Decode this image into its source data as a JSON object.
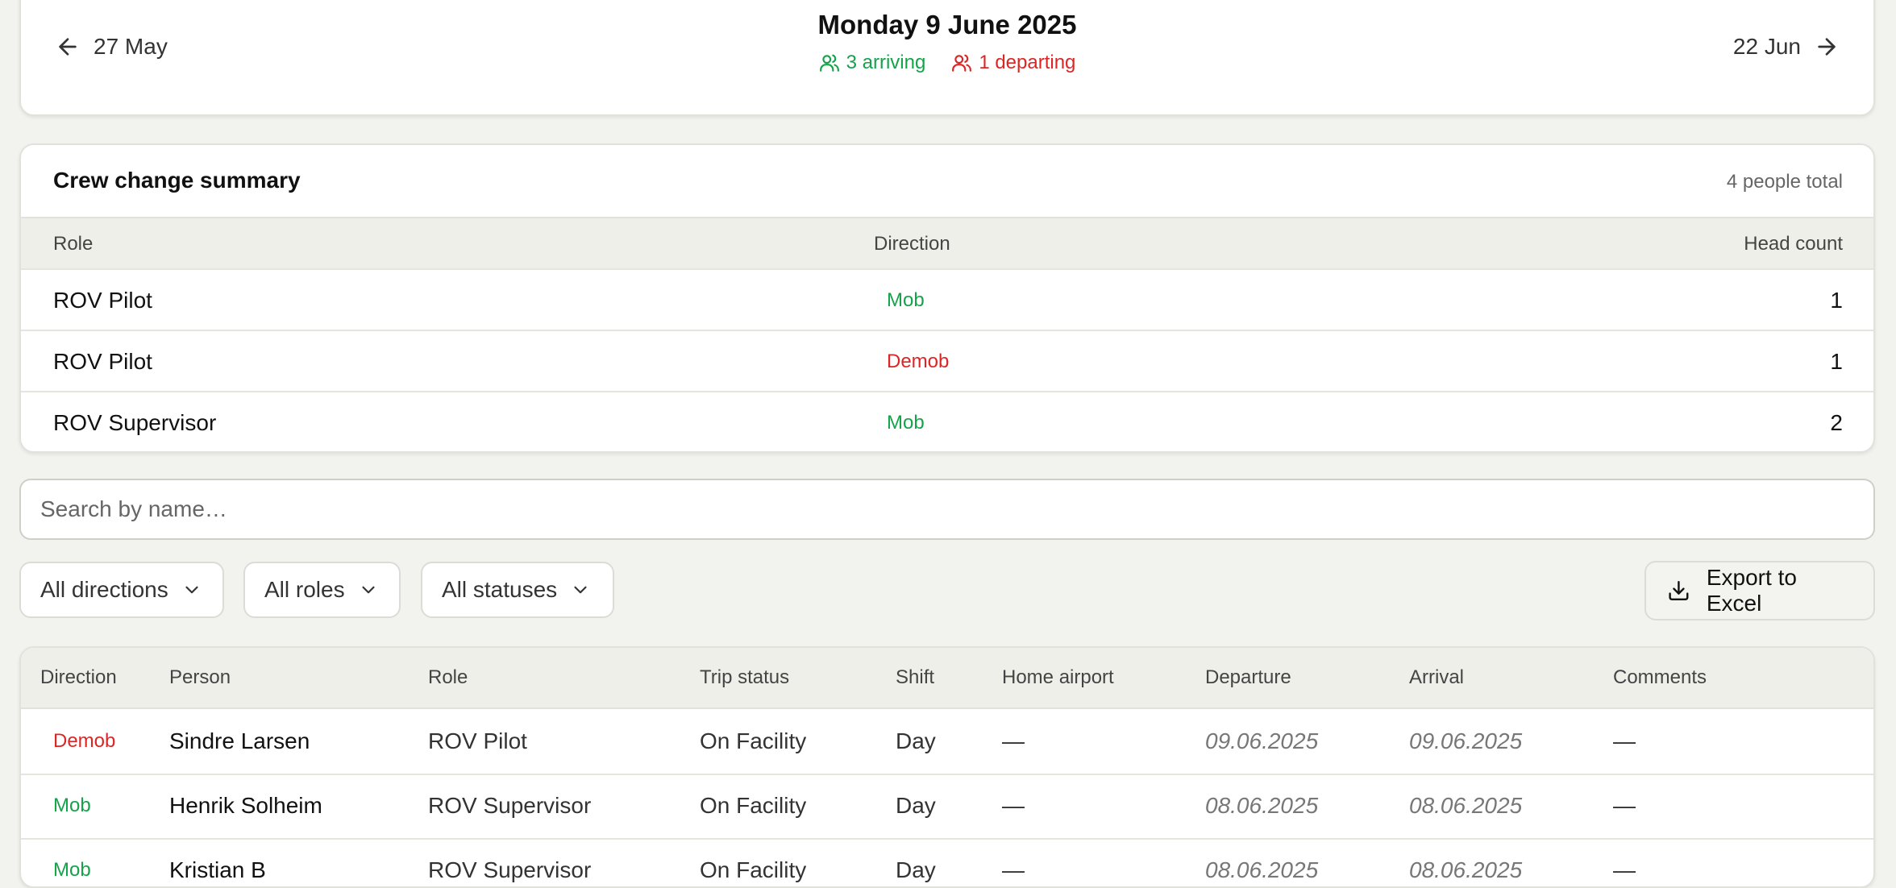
{
  "date_nav": {
    "prev_label": "27 May",
    "next_label": "22 Jun",
    "title": "Monday 9 June 2025",
    "arriving": "3 arriving",
    "departing": "1 departing"
  },
  "summary": {
    "title": "Crew change summary",
    "total": "4 people total",
    "headers": {
      "role": "Role",
      "direction": "Direction",
      "count": "Head count"
    },
    "rows": [
      {
        "role": "ROV Pilot",
        "direction": "Mob",
        "count": "1"
      },
      {
        "role": "ROV Pilot",
        "direction": "Demob",
        "count": "1"
      },
      {
        "role": "ROV Supervisor",
        "direction": "Mob",
        "count": "2"
      }
    ]
  },
  "search": {
    "placeholder": "Search by name…",
    "value": ""
  },
  "filters": {
    "directions": "All directions",
    "roles": "All roles",
    "statuses": "All statuses"
  },
  "export_label": "Export to Excel",
  "people": {
    "headers": {
      "direction": "Direction",
      "person": "Person",
      "role": "Role",
      "trip_status": "Trip status",
      "shift": "Shift",
      "home_airport": "Home airport",
      "departure": "Departure",
      "arrival": "Arrival",
      "comments": "Comments"
    },
    "rows": [
      {
        "direction": "Demob",
        "person": "Sindre Larsen",
        "role": "ROV Pilot",
        "trip_status": "On Facility",
        "shift": "Day",
        "home_airport": "—",
        "departure": "09.06.2025",
        "arrival": "09.06.2025",
        "comments": "—"
      },
      {
        "direction": "Mob",
        "person": "Henrik Solheim",
        "role": "ROV Supervisor",
        "trip_status": "On Facility",
        "shift": "Day",
        "home_airport": "—",
        "departure": "08.06.2025",
        "arrival": "08.06.2025",
        "comments": "—"
      },
      {
        "direction": "Mob",
        "person": "Kristian B",
        "role": "ROV Supervisor",
        "trip_status": "On Facility",
        "shift": "Day",
        "home_airport": "—",
        "departure": "08.06.2025",
        "arrival": "08.06.2025",
        "comments": "—"
      }
    ]
  },
  "colors": {
    "mob": "#15a34a",
    "demob": "#dc2626",
    "background": "#f2f2ee"
  }
}
